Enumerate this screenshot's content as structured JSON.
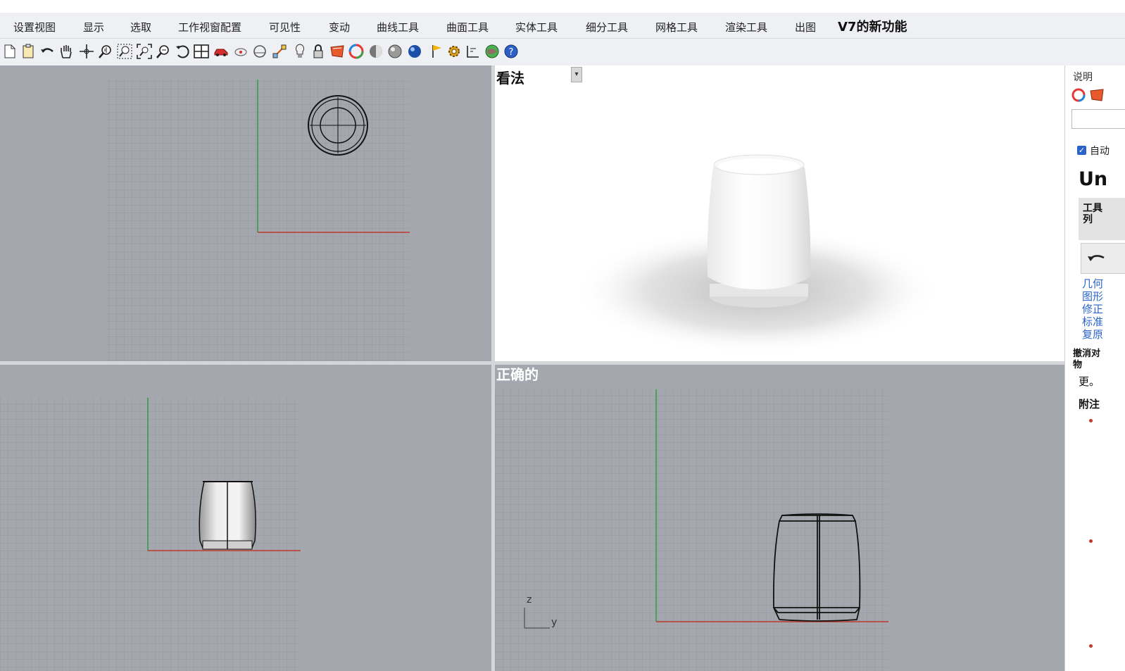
{
  "menu": {
    "items": [
      "设置视图",
      "显示",
      "选取",
      "工作视窗配置",
      "可见性",
      "变动",
      "曲线工具",
      "曲面工具",
      "实体工具",
      "细分工具",
      "网格工具",
      "渲染工具",
      "出图"
    ],
    "whats_new": "V7的新功能"
  },
  "toolbar": {
    "icons": [
      "new-icon",
      "clipboard-icon",
      "undo-icon",
      "pan-hand-icon",
      "move-icon",
      "zoom-icon",
      "zoom-window-icon",
      "zoom-extents-icon",
      "zoom-selected-icon",
      "rotate-view-icon",
      "four-viewports-icon",
      "car-icon",
      "options-icon",
      "snap-icon",
      "osnap-icon",
      "light-icon",
      "lock-icon",
      "render-icon",
      "color-wheel-icon",
      "shade-sphere-icon",
      "rendered-sphere-icon",
      "material-sphere-icon",
      "flag-icon",
      "settings-gear-icon",
      "dimension-icon",
      "globe-icon",
      "help-icon"
    ]
  },
  "viewports": {
    "perspective": {
      "label": "看法"
    },
    "right": {
      "label": "正确的"
    },
    "axis_z": "z",
    "axis_y": "y"
  },
  "right_panel": {
    "title": "说明",
    "checkbox_label": "自动",
    "heading": "Un",
    "tool_label_1": "工具",
    "tool_label_2": "列",
    "links": [
      "几何",
      "图形",
      "修正",
      "标准",
      "复原"
    ],
    "desc_1": "撤消对",
    "desc_2": "物",
    "desc_3": "更。",
    "notes_title": "附注"
  },
  "colors": {
    "viewport_bg": "#a4a8ae",
    "grid_line": "#8f949b",
    "x_axis": "#c0392b",
    "y_axis": "#2e9e3e",
    "link": "#2a64c8"
  }
}
